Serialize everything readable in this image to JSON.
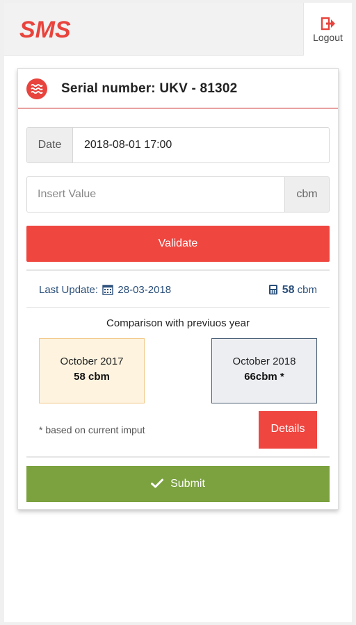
{
  "header": {
    "logo_text": "SMS",
    "logout_label": "Logout",
    "logout_icon": "logout-icon"
  },
  "card": {
    "serial_icon": "water-waves-icon",
    "serial_title": "Serial number: UKV - 81302",
    "date_label": "Date",
    "date_value": "2018-08-01 17:00",
    "value_placeholder": "Insert Value",
    "value_unit": "cbm",
    "validate_label": "Validate",
    "last_update_label": "Last Update:",
    "last_update_icon": "calendar-icon",
    "last_update_date": "28-03-2018",
    "meter_icon": "meter-icon",
    "meter_value": "58",
    "meter_unit": "cbm",
    "comparison_title": "Comparison with previuos year",
    "previous": {
      "month": "October 2017",
      "value": "58 cbm"
    },
    "current": {
      "month": "October 2018",
      "value": "66cbm *"
    },
    "footnote": "* based on current imput",
    "details_label": "Details",
    "submit_label": "Submit",
    "submit_icon": "check-icon"
  },
  "colors": {
    "brand_red": "#ef4640",
    "submit_green": "#7ba23f",
    "link_blue": "#2a4f7a"
  }
}
